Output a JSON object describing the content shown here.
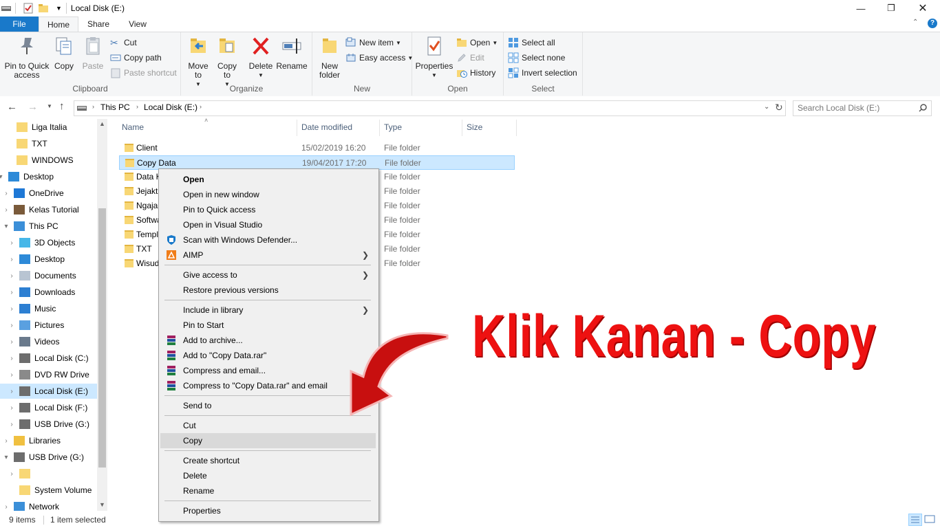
{
  "window": {
    "title": "Local Disk (E:)"
  },
  "tabs": [
    "File",
    "Home",
    "Share",
    "View"
  ],
  "ribbon": {
    "clipboard": {
      "label": "Clipboard",
      "pin": "Pin to Quick access",
      "copy": "Copy",
      "paste": "Paste",
      "cut": "Cut",
      "copy_path": "Copy path",
      "paste_shortcut": "Paste shortcut"
    },
    "organize": {
      "label": "Organize",
      "move_to": "Move to",
      "copy_to": "Copy to",
      "delete": "Delete",
      "rename": "Rename"
    },
    "new": {
      "label": "New",
      "new_folder": "New folder",
      "new_item": "New item",
      "easy_access": "Easy access"
    },
    "open": {
      "label": "Open",
      "properties": "Properties",
      "open": "Open",
      "edit": "Edit",
      "history": "History"
    },
    "select": {
      "label": "Select",
      "select_all": "Select all",
      "select_none": "Select none",
      "invert": "Invert selection"
    }
  },
  "address": {
    "crumbs": [
      "This PC",
      "Local Disk (E:)"
    ],
    "search_placeholder": "Search Local Disk (E:)"
  },
  "nav": [
    {
      "label": "Liga Italia",
      "icon": "folder-icon"
    },
    {
      "label": "TXT",
      "icon": "folder-icon"
    },
    {
      "label": "WINDOWS",
      "icon": "folder-icon"
    },
    {
      "label": "Desktop",
      "icon": "desktop-icon"
    },
    {
      "label": "OneDrive",
      "icon": "cloud-icon"
    },
    {
      "label": "Kelas Tutorial",
      "icon": "user-icon"
    },
    {
      "label": "This PC",
      "icon": "pc-icon"
    },
    {
      "label": "3D Objects",
      "icon": "cube-icon"
    },
    {
      "label": "Desktop",
      "icon": "desktop-icon"
    },
    {
      "label": "Documents",
      "icon": "document-icon"
    },
    {
      "label": "Downloads",
      "icon": "download-icon"
    },
    {
      "label": "Music",
      "icon": "music-icon"
    },
    {
      "label": "Pictures",
      "icon": "picture-icon"
    },
    {
      "label": "Videos",
      "icon": "video-icon"
    },
    {
      "label": "Local Disk (C:)",
      "icon": "drive-icon"
    },
    {
      "label": "DVD RW Drive",
      "icon": "dvd-icon"
    },
    {
      "label": "Local Disk (E:)",
      "icon": "drive-icon"
    },
    {
      "label": "Local Disk (F:)",
      "icon": "drive-icon"
    },
    {
      "label": "USB Drive (G:)",
      "icon": "usb-icon"
    },
    {
      "label": "Libraries",
      "icon": "library-icon"
    },
    {
      "label": "USB Drive (G:)",
      "icon": "usb-icon"
    },
    {
      "label": "",
      "icon": "folder-icon"
    },
    {
      "label": "System Volume",
      "icon": "folder-icon"
    },
    {
      "label": "Network",
      "icon": "network-icon"
    }
  ],
  "columns": {
    "name": "Name",
    "date": "Date modified",
    "type": "Type",
    "size": "Size"
  },
  "files": [
    {
      "name": "Client",
      "date": "15/02/2019 16:20",
      "type": "File folder"
    },
    {
      "name": "Copy Data",
      "date": "19/04/2017 17:20",
      "type": "File folder"
    },
    {
      "name": "Data K",
      "date": "",
      "type": "File folder"
    },
    {
      "name": "Jejaktu",
      "date": "",
      "type": "File folder"
    },
    {
      "name": "Ngaja",
      "date": "",
      "type": "File folder"
    },
    {
      "name": "Softwa",
      "date": "",
      "type": "File folder"
    },
    {
      "name": "Templ",
      "date": "",
      "type": "File folder"
    },
    {
      "name": "TXT",
      "date": "",
      "type": "File folder"
    },
    {
      "name": "Wisud",
      "date": "",
      "type": "File folder"
    }
  ],
  "context_menu": {
    "open": "Open",
    "open_new_window": "Open in new window",
    "pin_quick": "Pin to Quick access",
    "open_vs": "Open in Visual Studio",
    "scan": "Scan with Windows Defender...",
    "aimp": "AIMP",
    "give_access": "Give access to",
    "restore": "Restore previous versions",
    "include_library": "Include in library",
    "pin_start": "Pin to Start",
    "add_archive": "Add to archive...",
    "add_rar": "Add to \"Copy Data.rar\"",
    "compress_email": "Compress and email...",
    "compress_rar_email": "Compress to \"Copy Data.rar\" and email",
    "send_to": "Send to",
    "cut": "Cut",
    "copy": "Copy",
    "create_shortcut": "Create shortcut",
    "delete": "Delete",
    "rename": "Rename",
    "properties": "Properties"
  },
  "status": {
    "items": "9 items",
    "selected": "1 item selected"
  },
  "overlay": {
    "text": "Klik Kanan - Copy",
    "color": "#ee1111"
  },
  "colors": {
    "accent": "#1979ca",
    "selection": "#cce8ff"
  }
}
